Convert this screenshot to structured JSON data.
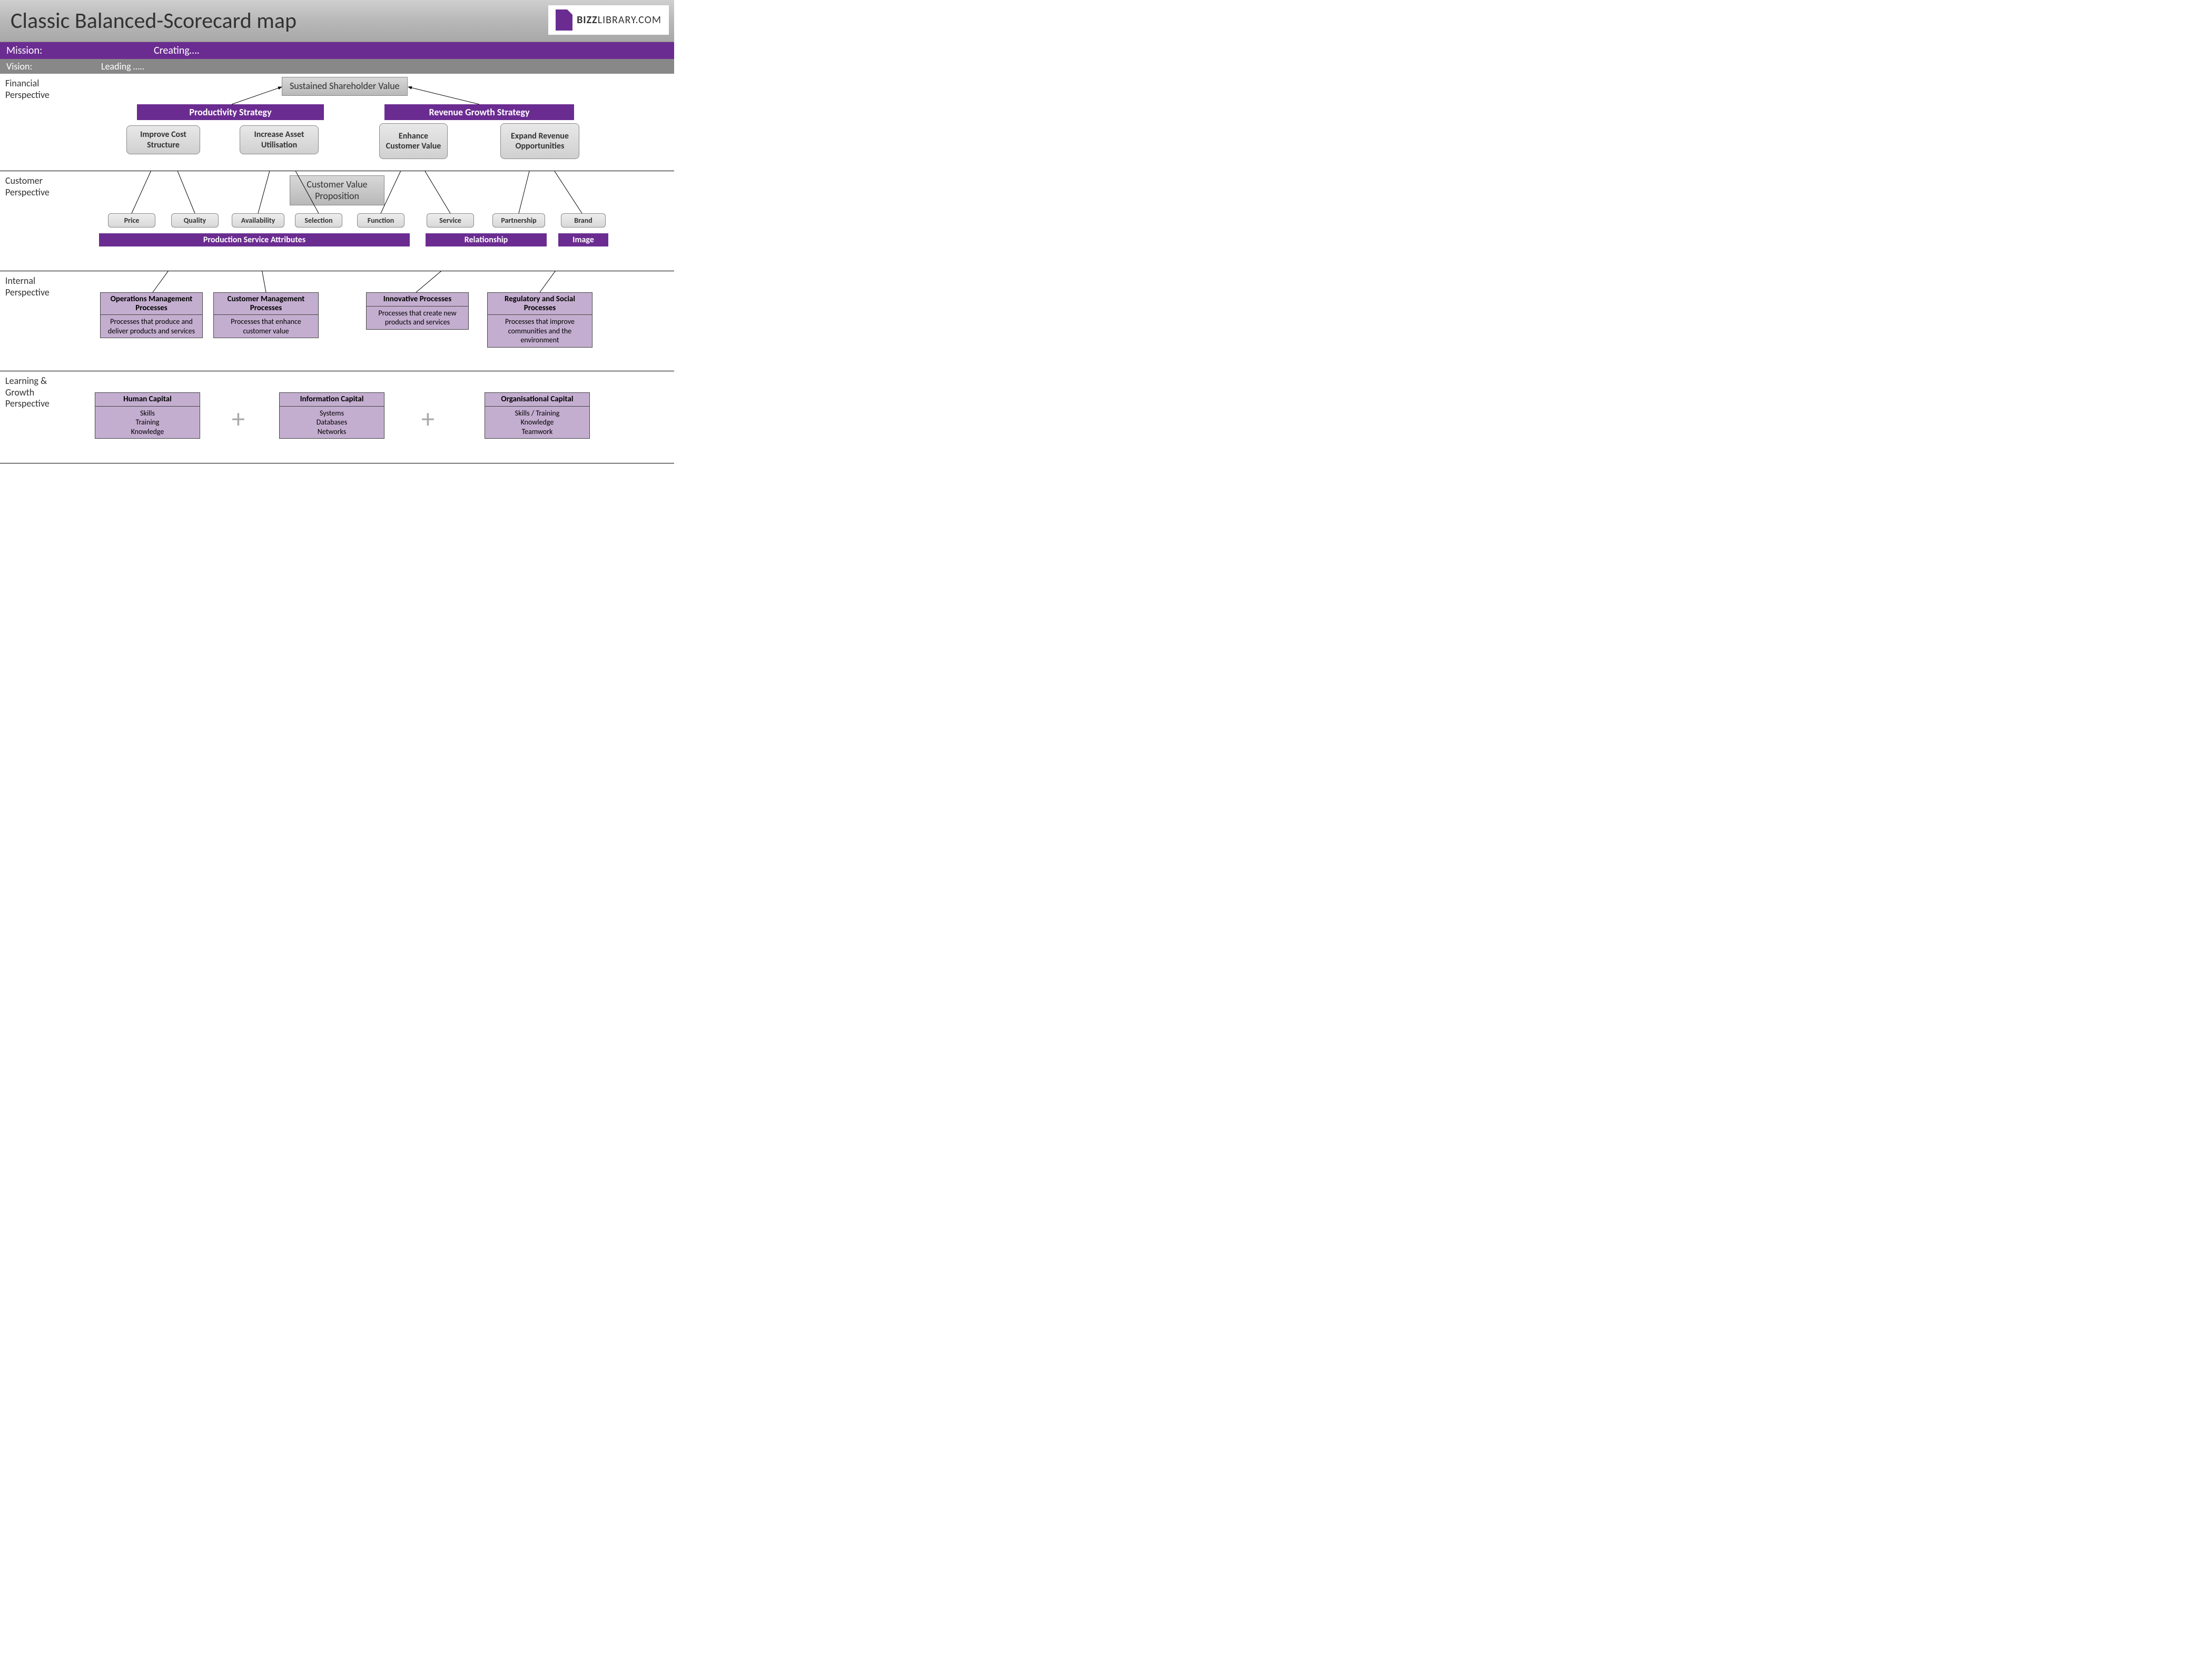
{
  "title": "Classic Balanced-Scorecard map",
  "logo": {
    "bold": "BIZZ",
    "light": "LIBRARY.COM"
  },
  "mission": {
    "label": "Mission:",
    "value": "Creating…."
  },
  "vision": {
    "label": "Vision:",
    "value": "Leading ….."
  },
  "perspectives": {
    "financial": "Financial Perspective",
    "customer": "Customer Perspective",
    "internal": "Internal Perspective",
    "learning": "Learning & Growth Perspective"
  },
  "financial": {
    "top": "Sustained Shareholder Value",
    "prod_strategy": "Productivity Strategy",
    "rev_strategy": "Revenue Growth Strategy",
    "improve_cost": "Improve Cost Structure",
    "increase_asset": "Increase Asset Utilisation",
    "enhance_customer": "Enhance Customer Value",
    "expand_revenue": "Expand Revenue Opportunities"
  },
  "customer": {
    "cvp": "Customer Value Proposition",
    "pills": [
      "Price",
      "Quality",
      "Availability",
      "Selection",
      "Function",
      "Service",
      "Partnership",
      "Brand"
    ],
    "band_psa": "Production Service Attributes",
    "band_rel": "Relationship",
    "band_img": "Image"
  },
  "internal": {
    "boxes": [
      {
        "t": "Operations Management Processes",
        "b": "Processes that produce and deliver products and services"
      },
      {
        "t": "Customer Management Processes",
        "b": "Processes that enhance customer value"
      },
      {
        "t": "Innovative Processes",
        "b": "Processes that create new products and services"
      },
      {
        "t": "Regulatory and Social Processes",
        "b": "Processes that improve communities and the environment"
      }
    ]
  },
  "learning": {
    "boxes": [
      {
        "t": "Human Capital",
        "b": "Skills\nTraining\nKnowledge"
      },
      {
        "t": "Information Capital",
        "b": "Systems\nDatabases\nNetworks"
      },
      {
        "t": "Organisational Capital",
        "b": "Skills / Training\nKnowledge\nTeamwork"
      }
    ]
  }
}
